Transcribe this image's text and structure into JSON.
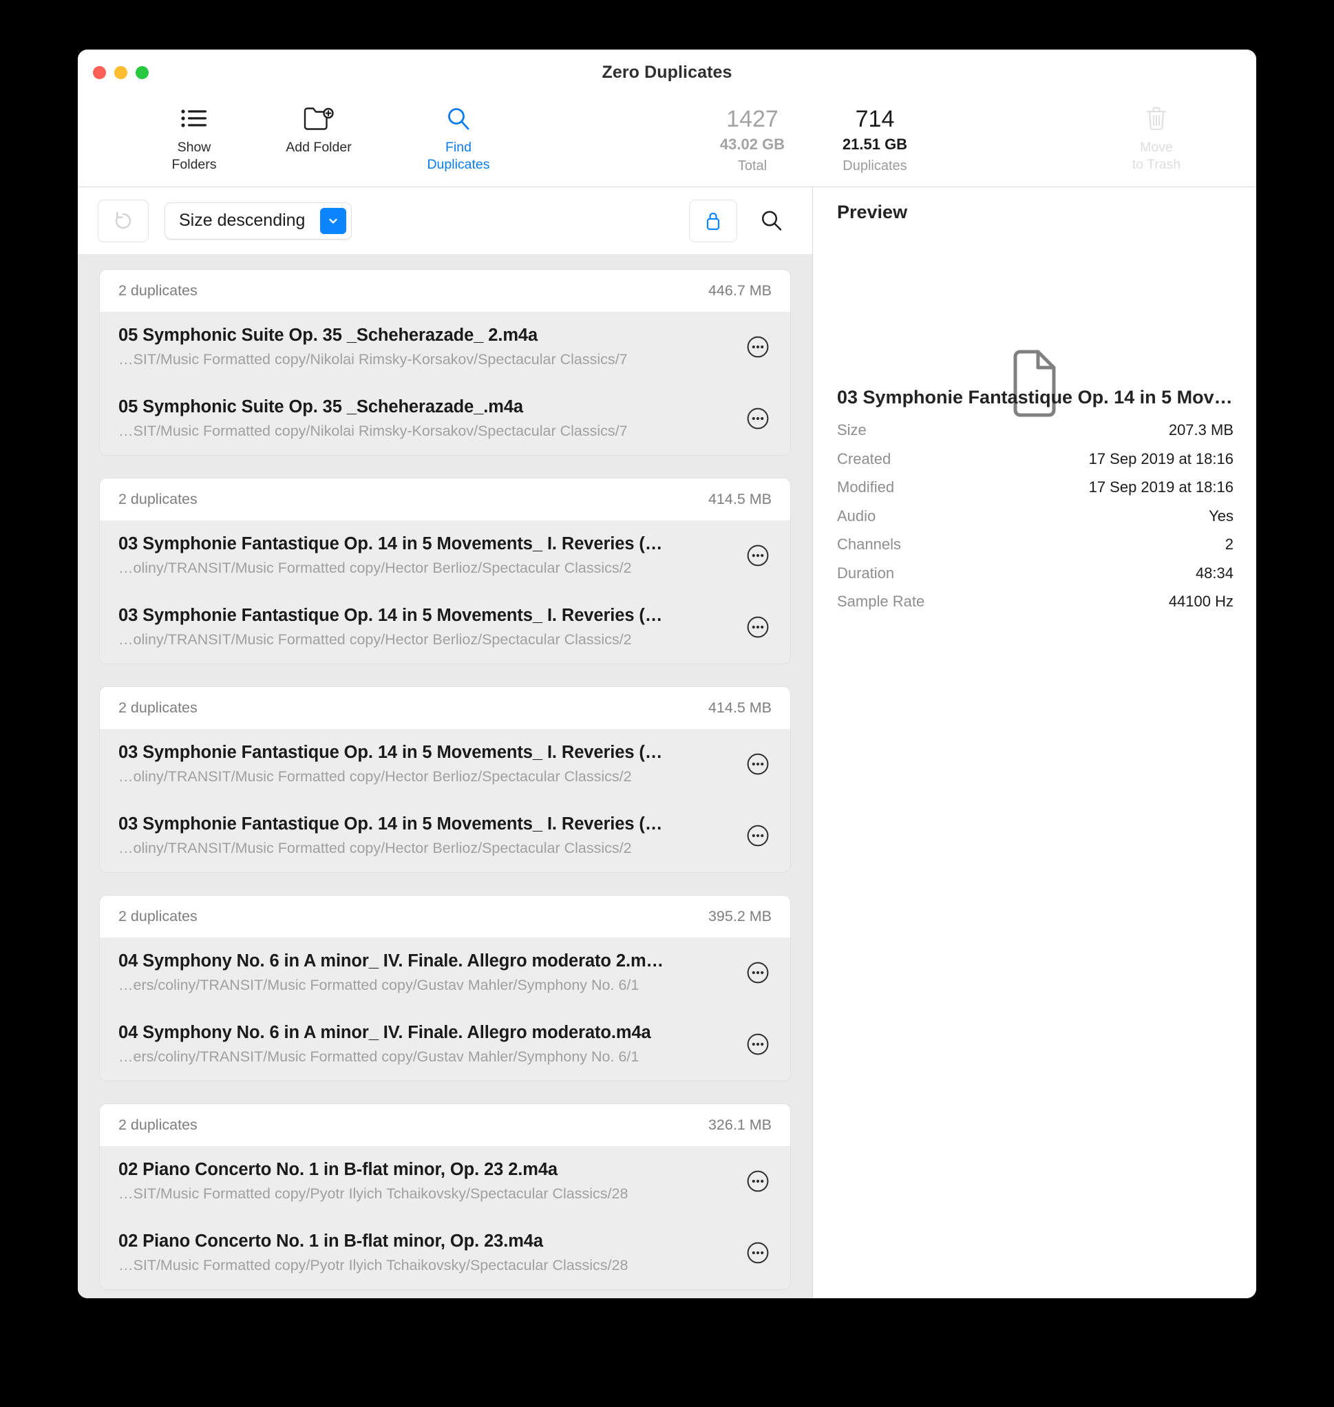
{
  "window": {
    "title": "Zero Duplicates",
    "traffic_lights": [
      "close",
      "minimize",
      "zoom"
    ]
  },
  "toolbar": {
    "show_folders_label": "Show\nFolders",
    "add_folder_label": "Add Folder",
    "find_duplicates_label": "Find\nDuplicates",
    "move_to_trash_label": "Move\nto Trash",
    "accent_color": "#0a7cf0",
    "stats": [
      {
        "count": "1427",
        "size": "43.02 GB",
        "label": "Total",
        "emphasis": "dim"
      },
      {
        "count": "714",
        "size": "21.51 GB",
        "label": "Duplicates",
        "emphasis": "strong"
      }
    ]
  },
  "filterbar": {
    "reset_icon": "undo-arrow-icon",
    "sort_value": "Size descending",
    "sort_options": [
      "Size descending"
    ],
    "lock_icon": "lock-icon",
    "lock_color": "#0a84ff",
    "search_icon": "search-icon"
  },
  "groups": [
    {
      "count_label": "2 duplicates",
      "size_label": "446.7 MB",
      "files": [
        {
          "name": "05 Symphonic Suite Op. 35 _Scheherazade_ 2.m4a",
          "path": "…SIT/Music Formatted copy/Nikolai Rimsky-Korsakov/Spectacular Classics/7"
        },
        {
          "name": "05 Symphonic Suite Op. 35 _Scheherazade_.m4a",
          "path": "…SIT/Music Formatted copy/Nikolai Rimsky-Korsakov/Spectacular Classics/7"
        }
      ]
    },
    {
      "count_label": "2 duplicates",
      "size_label": "414.5 MB",
      "files": [
        {
          "name": "03 Symphonie Fantastique Op. 14 in 5 Movements_ I. Reveries (…",
          "path": "…oliny/TRANSIT/Music Formatted copy/Hector Berlioz/Spectacular Classics/2"
        },
        {
          "name": "03 Symphonie Fantastique Op. 14 in 5 Movements_ I. Reveries (…",
          "path": "…oliny/TRANSIT/Music Formatted copy/Hector Berlioz/Spectacular Classics/2"
        }
      ]
    },
    {
      "count_label": "2 duplicates",
      "size_label": "414.5 MB",
      "files": [
        {
          "name": "03 Symphonie Fantastique Op. 14 in 5 Movements_ I. Reveries (…",
          "path": "…oliny/TRANSIT/Music Formatted copy/Hector Berlioz/Spectacular Classics/2"
        },
        {
          "name": "03 Symphonie Fantastique Op. 14 in 5 Movements_ I. Reveries (…",
          "path": "…oliny/TRANSIT/Music Formatted copy/Hector Berlioz/Spectacular Classics/2"
        }
      ]
    },
    {
      "count_label": "2 duplicates",
      "size_label": "395.2 MB",
      "files": [
        {
          "name": "04 Symphony No. 6 in A minor_ IV. Finale. Allegro moderato 2.m…",
          "path": "…ers/coliny/TRANSIT/Music Formatted copy/Gustav Mahler/Symphony No. 6/1"
        },
        {
          "name": "04 Symphony No. 6 in A minor_ IV. Finale. Allegro moderato.m4a",
          "path": "…ers/coliny/TRANSIT/Music Formatted copy/Gustav Mahler/Symphony No. 6/1"
        }
      ]
    },
    {
      "count_label": "2 duplicates",
      "size_label": "326.1 MB",
      "files": [
        {
          "name": "02 Piano Concerto No. 1 in B-flat minor, Op. 23 2.m4a",
          "path": "…SIT/Music Formatted copy/Pyotr Ilyich Tchaikovsky/Spectacular Classics/28"
        },
        {
          "name": "02 Piano Concerto No. 1 in B-flat minor, Op. 23.m4a",
          "path": "…SIT/Music Formatted copy/Pyotr Ilyich Tchaikovsky/Spectacular Classics/28"
        }
      ]
    }
  ],
  "preview": {
    "header": "Preview",
    "thumb_icon": "document-icon",
    "file_title": "03 Symphonie Fantastique Op. 14 in 5 Mov…",
    "metadata": [
      {
        "key": "Size",
        "value": "207.3 MB"
      },
      {
        "key": "Created",
        "value": "17 Sep 2019 at 18:16"
      },
      {
        "key": "Modified",
        "value": "17 Sep 2019 at 18:16"
      },
      {
        "key": "Audio",
        "value": "Yes"
      },
      {
        "key": "Channels",
        "value": "2"
      },
      {
        "key": "Duration",
        "value": "48:34"
      },
      {
        "key": "Sample Rate",
        "value": "44100 Hz"
      }
    ]
  }
}
